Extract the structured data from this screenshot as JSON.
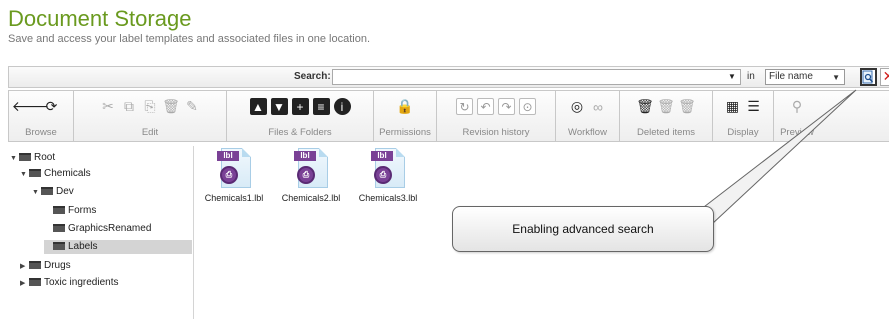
{
  "header": {
    "title": "Document Storage",
    "subtitle": "Save and access your label templates and associated files in one location."
  },
  "search": {
    "label": "Search:",
    "value": "",
    "placeholder": "",
    "in_label": "in",
    "scope_selected": "File name",
    "advanced_icon": "advanced-search-icon",
    "clear_icon": "close-icon"
  },
  "toolbar": {
    "groups": [
      {
        "label": "Browse",
        "icons": [
          "back-arrow-icon",
          "refresh-icon"
        ]
      },
      {
        "label": "Edit",
        "icons": [
          "cut-icon",
          "copy-icon",
          "paste-icon",
          "delete-icon",
          "rename-icon"
        ]
      },
      {
        "label": "Files & Folders",
        "icons": [
          "upload-icon",
          "download-icon",
          "new-folder-icon",
          "new-file-icon",
          "info-icon"
        ]
      },
      {
        "label": "Permissions",
        "icons": [
          "lock-icon"
        ]
      },
      {
        "label": "Revision history",
        "icons": [
          "revision-1-icon",
          "revision-2-icon",
          "revision-3-icon",
          "revision-4-icon"
        ]
      },
      {
        "label": "Workflow",
        "icons": [
          "workflow-icon",
          "workflow-link-icon"
        ]
      },
      {
        "label": "Deleted items",
        "icons": [
          "trash-icon",
          "restore-icon",
          "purge-icon"
        ]
      },
      {
        "label": "Display",
        "icons": [
          "grid-view-icon",
          "list-view-icon"
        ]
      },
      {
        "label": "Preview",
        "icons": [
          "preview-search-icon"
        ]
      }
    ]
  },
  "tree": {
    "root": "Root",
    "chemicals": "Chemicals",
    "dev": "Dev",
    "forms": "Forms",
    "graphics": "GraphicsRenamed",
    "labels": "Labels",
    "drugs": "Drugs",
    "toxic": "Toxic ingredients"
  },
  "files": [
    {
      "name": "Chemicals1.lbl",
      "tag": "lbl"
    },
    {
      "name": "Chemicals2.lbl",
      "tag": "lbl"
    },
    {
      "name": "Chemicals3.lbl",
      "tag": "lbl"
    }
  ],
  "callout": {
    "text": "Enabling advanced search"
  },
  "colors": {
    "title_green": "#6a9a1f",
    "label_purple": "#7a4196",
    "clear_red": "#d0201e"
  }
}
